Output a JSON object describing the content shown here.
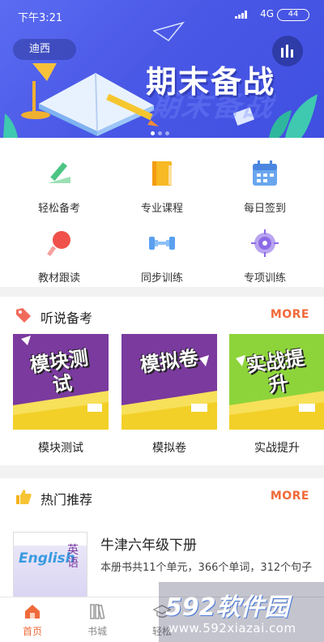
{
  "status_bar": {
    "time": "下午3:21",
    "network": "4G",
    "battery": "44"
  },
  "banner": {
    "city": "迪西",
    "title": "期末备战",
    "title_shadow": "期末备战",
    "slide_count": 3,
    "active_slide": 1
  },
  "quick_menu": [
    {
      "label": "轻松备考",
      "icon": "pencil-ruler-icon"
    },
    {
      "label": "专业课程",
      "icon": "book-icon"
    },
    {
      "label": "每日签到",
      "icon": "calendar-icon"
    },
    {
      "label": "教材跟读",
      "icon": "microphone-icon"
    },
    {
      "label": "同步训练",
      "icon": "dumbbell-icon"
    },
    {
      "label": "专项训练",
      "icon": "target-icon"
    }
  ],
  "listening_section": {
    "title": "听说备考",
    "more": "MORE",
    "cards": [
      {
        "art_text": "模块测试",
        "label": "模块测试"
      },
      {
        "art_text": "模拟卷",
        "label": "模拟卷"
      },
      {
        "art_text": "实战提升",
        "label": "实战提升"
      }
    ]
  },
  "hot_section": {
    "title": "热门推荐",
    "more": "MORE",
    "book": {
      "title": "牛津六年级下册",
      "description": "本册书共11个单元，366个单词，312个句子",
      "cover_text": "English",
      "cover_text_cn": "英语"
    }
  },
  "tabbar": [
    {
      "label": "首页",
      "icon": "home-icon",
      "active": true
    },
    {
      "label": "书城",
      "icon": "books-icon",
      "active": false
    },
    {
      "label": "轻松",
      "icon": "graduation-cap-icon",
      "active": false
    }
  ],
  "watermark": {
    "brand": "592软件园",
    "url": "www.592xiazai.com"
  },
  "colors": {
    "accent": "#f06a3a",
    "banner": "#4a58e6",
    "card_purple": "#7b3aa0",
    "card_green": "#8ed43a"
  }
}
